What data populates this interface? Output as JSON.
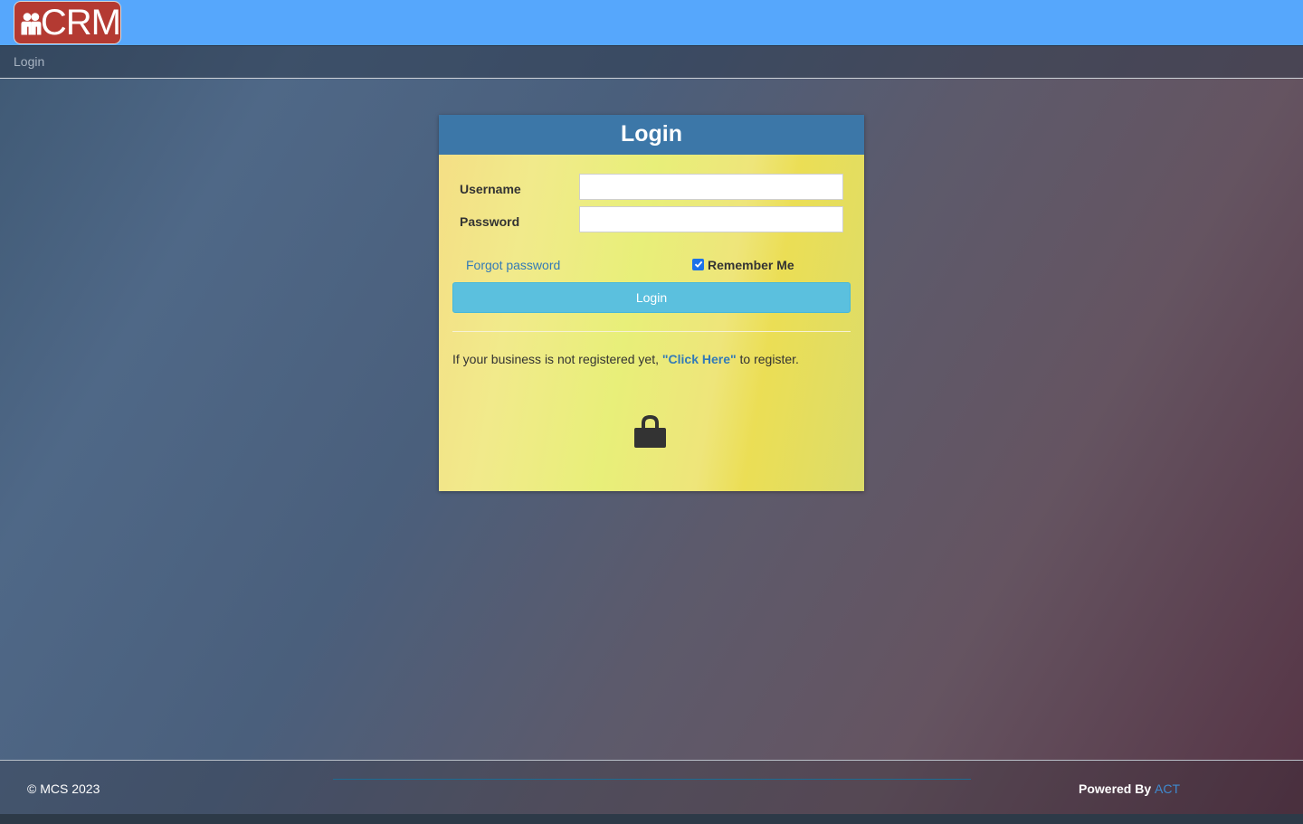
{
  "brand": {
    "logo_text": "CRM",
    "logo_color": "#b43a32",
    "topbar_color": "#56a7fc"
  },
  "breadcrumb": {
    "current": "Login"
  },
  "login_panel": {
    "title": "Login",
    "username_label": "Username",
    "username_value": "",
    "password_label": "Password",
    "password_value": "",
    "forgot_password": "Forgot password",
    "remember_me_label": "Remember Me",
    "remember_me_checked": true,
    "login_button": "Login",
    "register_prefix": "If your business is not registered yet, ",
    "register_link": "\"Click Here\"",
    "register_suffix": " to register.",
    "lock_icon": "lock-icon"
  },
  "footer": {
    "copyright": "© MCS 2023",
    "powered_by_label": "Powered By ",
    "powered_by_link": "ACT"
  }
}
